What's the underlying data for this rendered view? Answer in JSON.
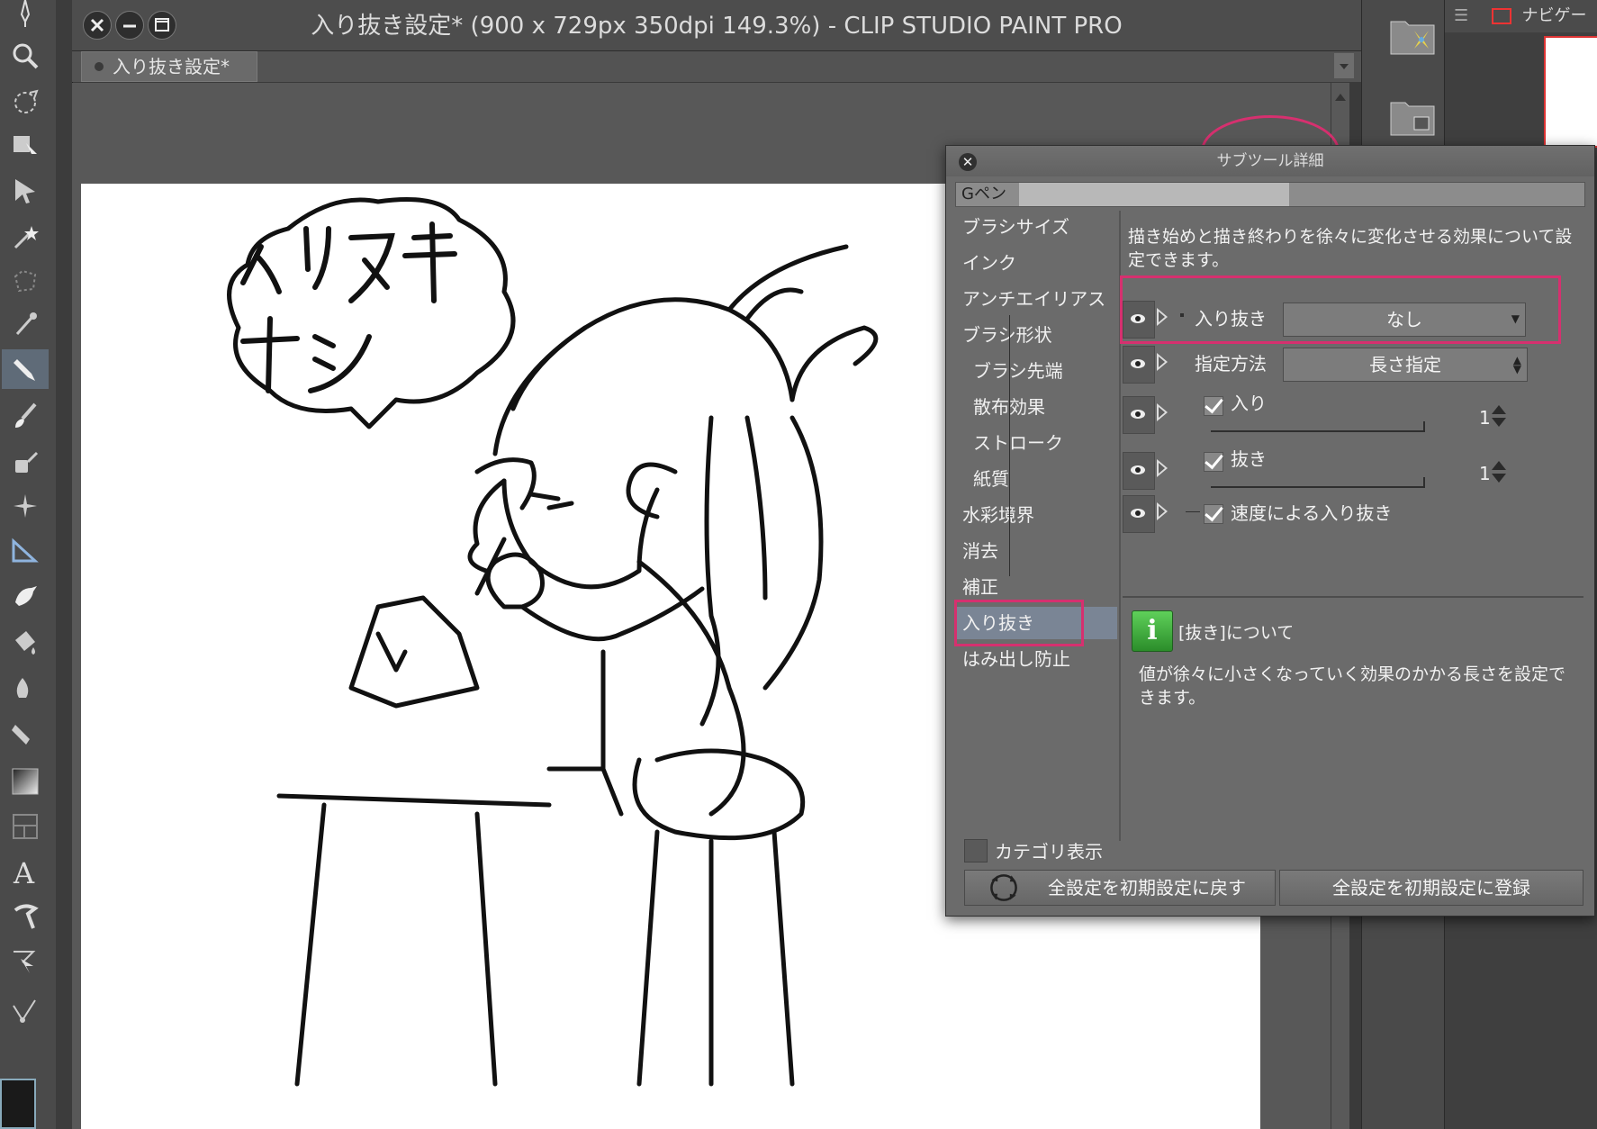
{
  "window": {
    "title": "入り抜き設定* (900 x 729px 350dpi 149.3%)  - CLIP STUDIO PAINT PRO",
    "tab_label": "入り抜き設定*"
  },
  "navigator": {
    "label": "ナビゲー"
  },
  "toolbar": {
    "tools": [
      "pen-nib-icon",
      "zoom-icon",
      "lasso-icon",
      "move-layer-icon",
      "operation-icon",
      "magic-wand-icon",
      "selection-pen-icon",
      "eyedropper-icon",
      "pen-icon",
      "brush-icon",
      "airbrush-icon",
      "decoration-icon",
      "ruler-icon",
      "bird-icon",
      "fill-icon",
      "blend-icon",
      "eraser-icon",
      "gradient-icon",
      "frame-icon",
      "text-icon",
      "balloon-icon",
      "correction-icon",
      "vector-icon",
      "color-icon"
    ]
  },
  "canvas": {
    "speech_text": "入リヌキ\nナシ"
  },
  "subtool_dialog": {
    "title": "サブツール詳細",
    "brush_name": "Gペン",
    "categories": [
      {
        "label": "ブラシサイズ",
        "sub": false
      },
      {
        "label": "インク",
        "sub": false
      },
      {
        "label": "アンチエイリアス",
        "sub": false
      },
      {
        "label": "ブラシ形状",
        "sub": false
      },
      {
        "label": "ブラシ先端",
        "sub": true
      },
      {
        "label": "散布効果",
        "sub": true
      },
      {
        "label": "ストローク",
        "sub": true
      },
      {
        "label": "紙質",
        "sub": true
      },
      {
        "label": "水彩境界",
        "sub": false
      },
      {
        "label": "消去",
        "sub": false
      },
      {
        "label": "補正",
        "sub": false
      },
      {
        "label": "入り抜き",
        "sub": false,
        "selected": true
      },
      {
        "label": "はみ出し防止",
        "sub": false
      }
    ],
    "description": "描き始めと描き終わりを徐々に変化させる効果について設定できます。",
    "props": {
      "taper_label": "入り抜き",
      "taper_value": "なし",
      "method_label": "指定方法",
      "method_value": "長さ指定",
      "start_label": "入り",
      "start_value": "1",
      "end_label": "抜き",
      "end_value": "1",
      "speed_label": "速度による入り抜き"
    },
    "info": {
      "title": "[抜き]について",
      "body": "値が徐々に小さくなっていく効果のかかる長さを設定できます。"
    },
    "category_toggle_label": "カテゴリ表示",
    "reset_all_label": "全設定を初期設定に戻す",
    "register_all_label": "全設定を初期設定に登録"
  },
  "colors": {
    "annotation": "#d6306f",
    "selected_category": "#7a8595"
  }
}
